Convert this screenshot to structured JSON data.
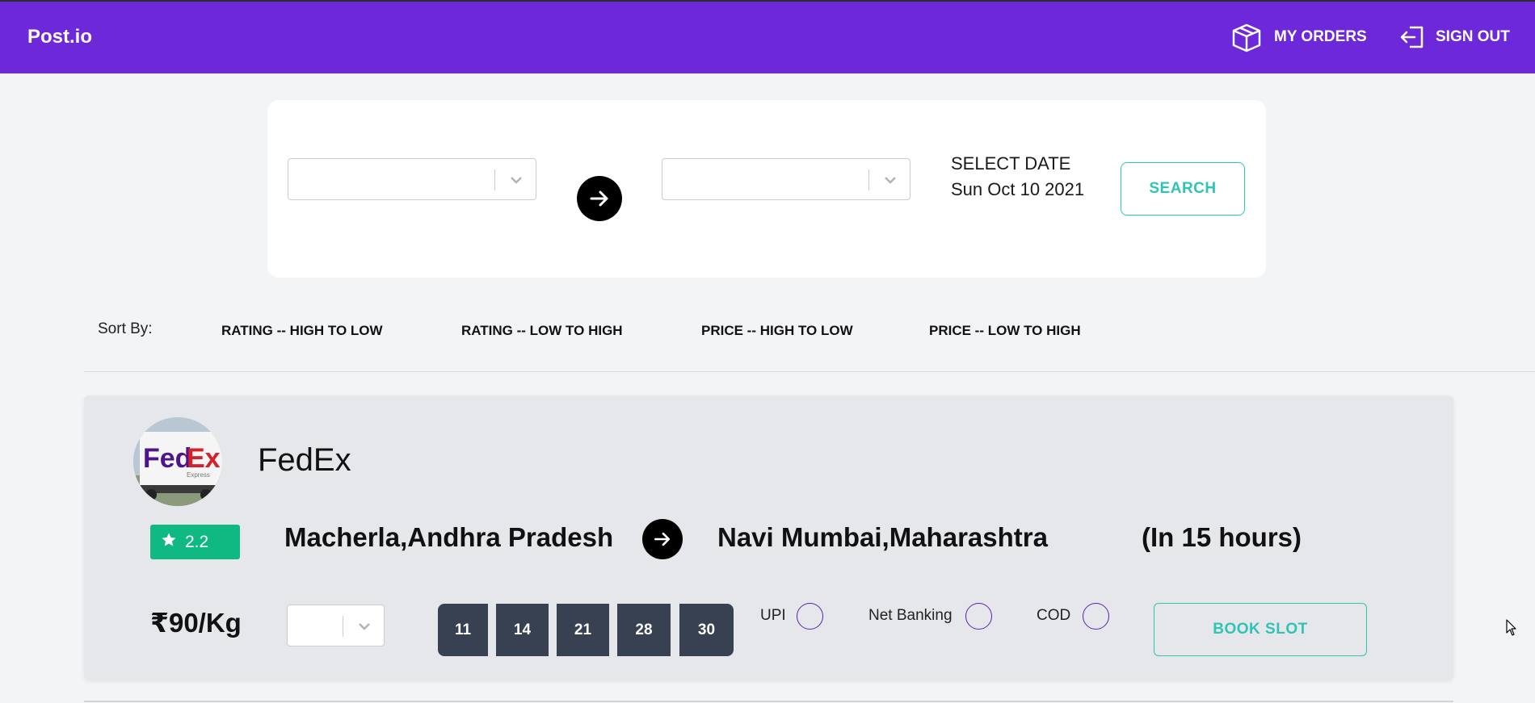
{
  "navbar": {
    "brand": "Post.io",
    "my_orders": "MY ORDERS",
    "sign_out": "SIGN OUT",
    "bg_color": "#6d28d9"
  },
  "search": {
    "from_value": "",
    "to_value": "",
    "date_label": "SELECT DATE",
    "date_value": "Sun Oct 10 2021",
    "search_label": "SEARCH"
  },
  "sort": {
    "label": "Sort By:",
    "options": [
      "RATING -- HIGH TO LOW",
      "RATING -- LOW TO HIGH",
      "PRICE -- HIGH TO LOW",
      "PRICE -- LOW TO HIGH"
    ]
  },
  "result": {
    "company": "FedEx",
    "logo_text": "FedEx",
    "logo_subtext": "Express",
    "rating": "2.2",
    "from": "Macherla,Andhra Pradesh",
    "to": "Navi Mumbai,Maharashtra",
    "eta": "(In 15 hours)",
    "price": "₹90/Kg",
    "qty_value": "",
    "dates": [
      "11",
      "14",
      "21",
      "28",
      "30"
    ],
    "payments": [
      "UPI",
      "Net Banking",
      "COD"
    ],
    "book_label": "BOOK SLOT",
    "rating_color": "#10b981",
    "accent_color": "#2ec4b6"
  }
}
